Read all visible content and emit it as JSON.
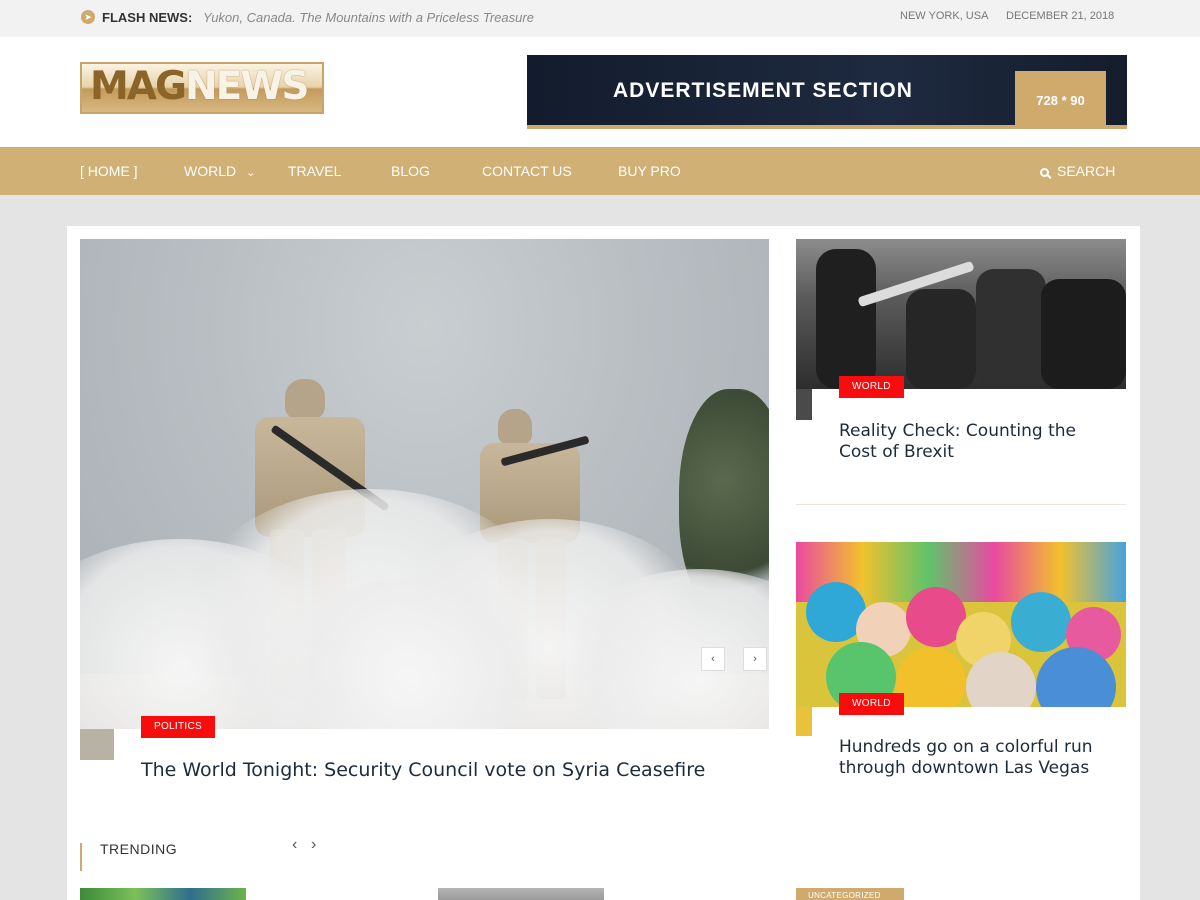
{
  "topbar": {
    "flash_label": "FLASH NEWS:",
    "flash_text": "Yukon, Canada. The Mountains with a Priceless Treasure",
    "location": "NEW YORK, USA",
    "date": "DECEMBER 21, 2018"
  },
  "header": {
    "logo_part1": "MAG",
    "logo_part2": "NEWS",
    "ad_title": "ADVERTISEMENT SECTION",
    "ad_size": "728 * 90"
  },
  "nav": {
    "items": [
      {
        "label": "[ HOME ]"
      },
      {
        "label": "WORLD"
      },
      {
        "label": "TRAVEL"
      },
      {
        "label": "BLOG"
      },
      {
        "label": "CONTACT US"
      },
      {
        "label": "BUY PRO"
      }
    ],
    "search_label": "SEARCH"
  },
  "feature": {
    "category": "POLITICS",
    "title": "The World Tonight: Security Council vote on Syria Ceasefire",
    "prev_icon": "‹",
    "next_icon": "›"
  },
  "side": [
    {
      "category": "WORLD",
      "title": "Reality Check: Counting the Cost of Brexit"
    },
    {
      "category": "WORLD",
      "title": "Hundreds go on a colorful run through downtown Las Vegas"
    }
  ],
  "trending": {
    "label": "TRENDING",
    "prev_icon": "‹",
    "next_icon": "›",
    "uncategorized_badge": "UNCATEGORIZED"
  },
  "colors": {
    "accent": "#d0aa6d",
    "category_badge": "#f70d0d",
    "ad_bg": "#131c2d"
  }
}
